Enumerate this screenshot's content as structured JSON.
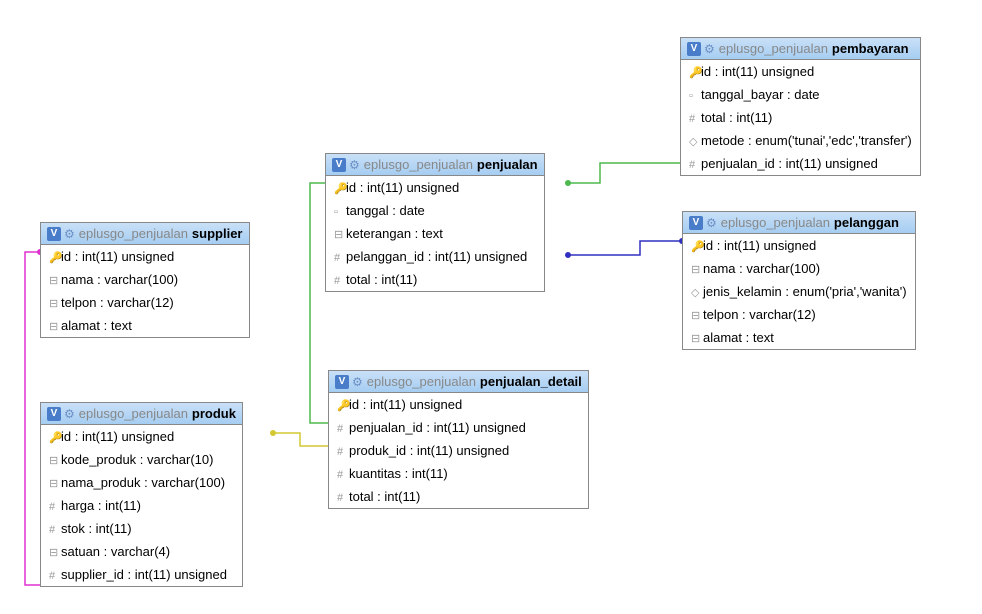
{
  "schema": "eplusgo_penjualan",
  "tables": {
    "supplier": {
      "name": "supplier",
      "cols": [
        {
          "i": "🔑",
          "t": "id : int(11) unsigned"
        },
        {
          "i": "⊟",
          "t": "nama : varchar(100)"
        },
        {
          "i": "⊟",
          "t": "telpon : varchar(12)"
        },
        {
          "i": "⊟",
          "t": "alamat : text"
        }
      ]
    },
    "produk": {
      "name": "produk",
      "cols": [
        {
          "i": "🔑",
          "t": "id : int(11) unsigned"
        },
        {
          "i": "⊟",
          "t": "kode_produk : varchar(10)"
        },
        {
          "i": "⊟",
          "t": "nama_produk : varchar(100)"
        },
        {
          "i": "#",
          "t": "harga : int(11)"
        },
        {
          "i": "#",
          "t": "stok : int(11)"
        },
        {
          "i": "⊟",
          "t": "satuan : varchar(4)"
        },
        {
          "i": "#",
          "t": "supplier_id : int(11) unsigned"
        }
      ]
    },
    "penjualan": {
      "name": "penjualan",
      "cols": [
        {
          "i": "🔑",
          "t": "id : int(11) unsigned"
        },
        {
          "i": "▫",
          "t": "tanggal : date"
        },
        {
          "i": "⊟",
          "t": "keterangan : text"
        },
        {
          "i": "#",
          "t": "pelanggan_id : int(11) unsigned"
        },
        {
          "i": "#",
          "t": "total : int(11)"
        }
      ]
    },
    "penjualan_detail": {
      "name": "penjualan_detail",
      "cols": [
        {
          "i": "🔑",
          "t": "id : int(11) unsigned"
        },
        {
          "i": "#",
          "t": "penjualan_id : int(11) unsigned"
        },
        {
          "i": "#",
          "t": "produk_id : int(11) unsigned"
        },
        {
          "i": "#",
          "t": "kuantitas : int(11)"
        },
        {
          "i": "#",
          "t": "total : int(11)"
        }
      ]
    },
    "pembayaran": {
      "name": "pembayaran",
      "cols": [
        {
          "i": "🔑",
          "t": "id : int(11) unsigned"
        },
        {
          "i": "▫",
          "t": "tanggal_bayar : date"
        },
        {
          "i": "#",
          "t": "total : int(11)"
        },
        {
          "i": "◇",
          "t": "metode : enum('tunai','edc','transfer')"
        },
        {
          "i": "#",
          "t": "penjualan_id : int(11) unsigned"
        }
      ]
    },
    "pelanggan": {
      "name": "pelanggan",
      "cols": [
        {
          "i": "🔑",
          "t": "id : int(11) unsigned"
        },
        {
          "i": "⊟",
          "t": "nama : varchar(100)"
        },
        {
          "i": "◇",
          "t": "jenis_kelamin : enum('pria','wanita')"
        },
        {
          "i": "⊟",
          "t": "telpon : varchar(12)"
        },
        {
          "i": "⊟",
          "t": "alamat : text"
        }
      ]
    }
  },
  "chart_data": {
    "type": "table",
    "description": "Entity-relationship diagram (phpMyAdmin Designer) for database eplusgo_penjualan",
    "entities": [
      "supplier",
      "produk",
      "penjualan",
      "penjualan_detail",
      "pembayaran",
      "pelanggan"
    ],
    "relationships": [
      {
        "from": "produk.supplier_id",
        "to": "supplier.id",
        "color": "magenta"
      },
      {
        "from": "penjualan_detail.produk_id",
        "to": "produk.id",
        "color": "yellow"
      },
      {
        "from": "penjualan_detail.penjualan_id",
        "to": "penjualan.id",
        "color": "green"
      },
      {
        "from": "pembayaran.penjualan_id",
        "to": "penjualan.id",
        "color": "green"
      },
      {
        "from": "penjualan.pelanggan_id",
        "to": "pelanggan.id",
        "color": "blue"
      }
    ]
  }
}
